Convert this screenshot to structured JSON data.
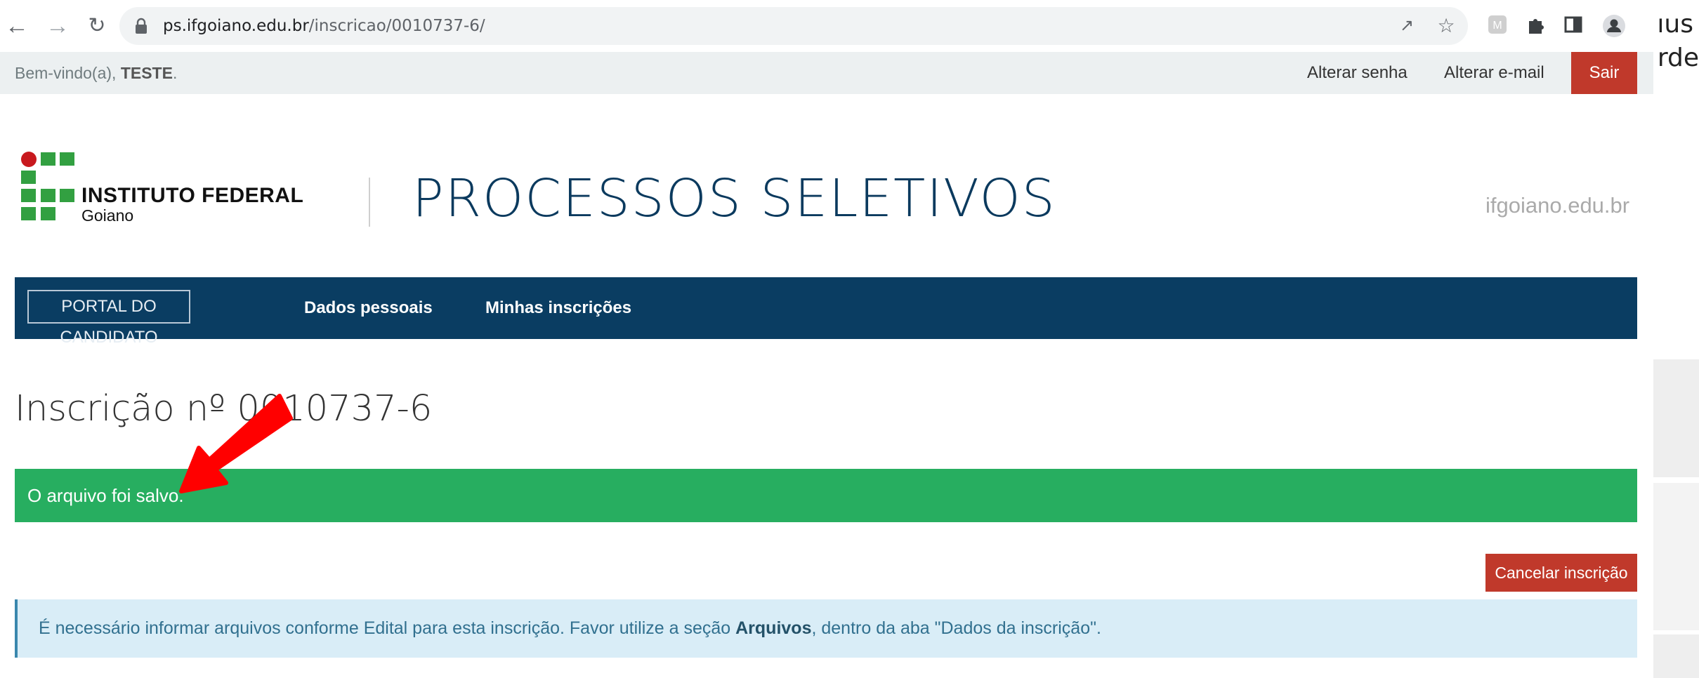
{
  "browser": {
    "url_host": "ps.ifgoiano.edu.br",
    "url_path": "/inscricao/0010737-6/",
    "back_icon": "arrow-left-icon",
    "forward_icon": "arrow-right-icon",
    "reload_icon": "reload-icon",
    "ext_text_1": "ıus",
    "ext_text_2": "rde"
  },
  "userbar": {
    "welcome": "Bem-vindo(a),",
    "user": "TESTE",
    "welcome_end": ".",
    "change_password": "Alterar senha",
    "change_email": "Alterar e-mail",
    "logout": "Sair"
  },
  "header": {
    "logo_title": "INSTITUTO FEDERAL",
    "logo_sub": "Goiano",
    "title": "PROCESSOS SELETIVOS",
    "domain": "ifgoiano.edu.br"
  },
  "nav": {
    "portal": "PORTAL DO CANDIDATO",
    "personal": "Dados pessoais",
    "registrations": "Minhas inscrições"
  },
  "main": {
    "heading": "Inscrição nº 0010737-6",
    "success_msg": "O arquivo foi salvo.",
    "cancel_button": "Cancelar inscrição",
    "info_before": "É necessário informar arquivos conforme Edital para esta inscrição. Favor utilize a seção ",
    "info_bold": "Arquivos",
    "info_after": ", dentro da aba \"Dados da inscrição\"."
  },
  "colors": {
    "navbar": "#0a3d62",
    "success": "#27ae60",
    "danger": "#c0392b",
    "info_bg": "#d9edf7",
    "annotation_arrow": "#ff0000"
  }
}
